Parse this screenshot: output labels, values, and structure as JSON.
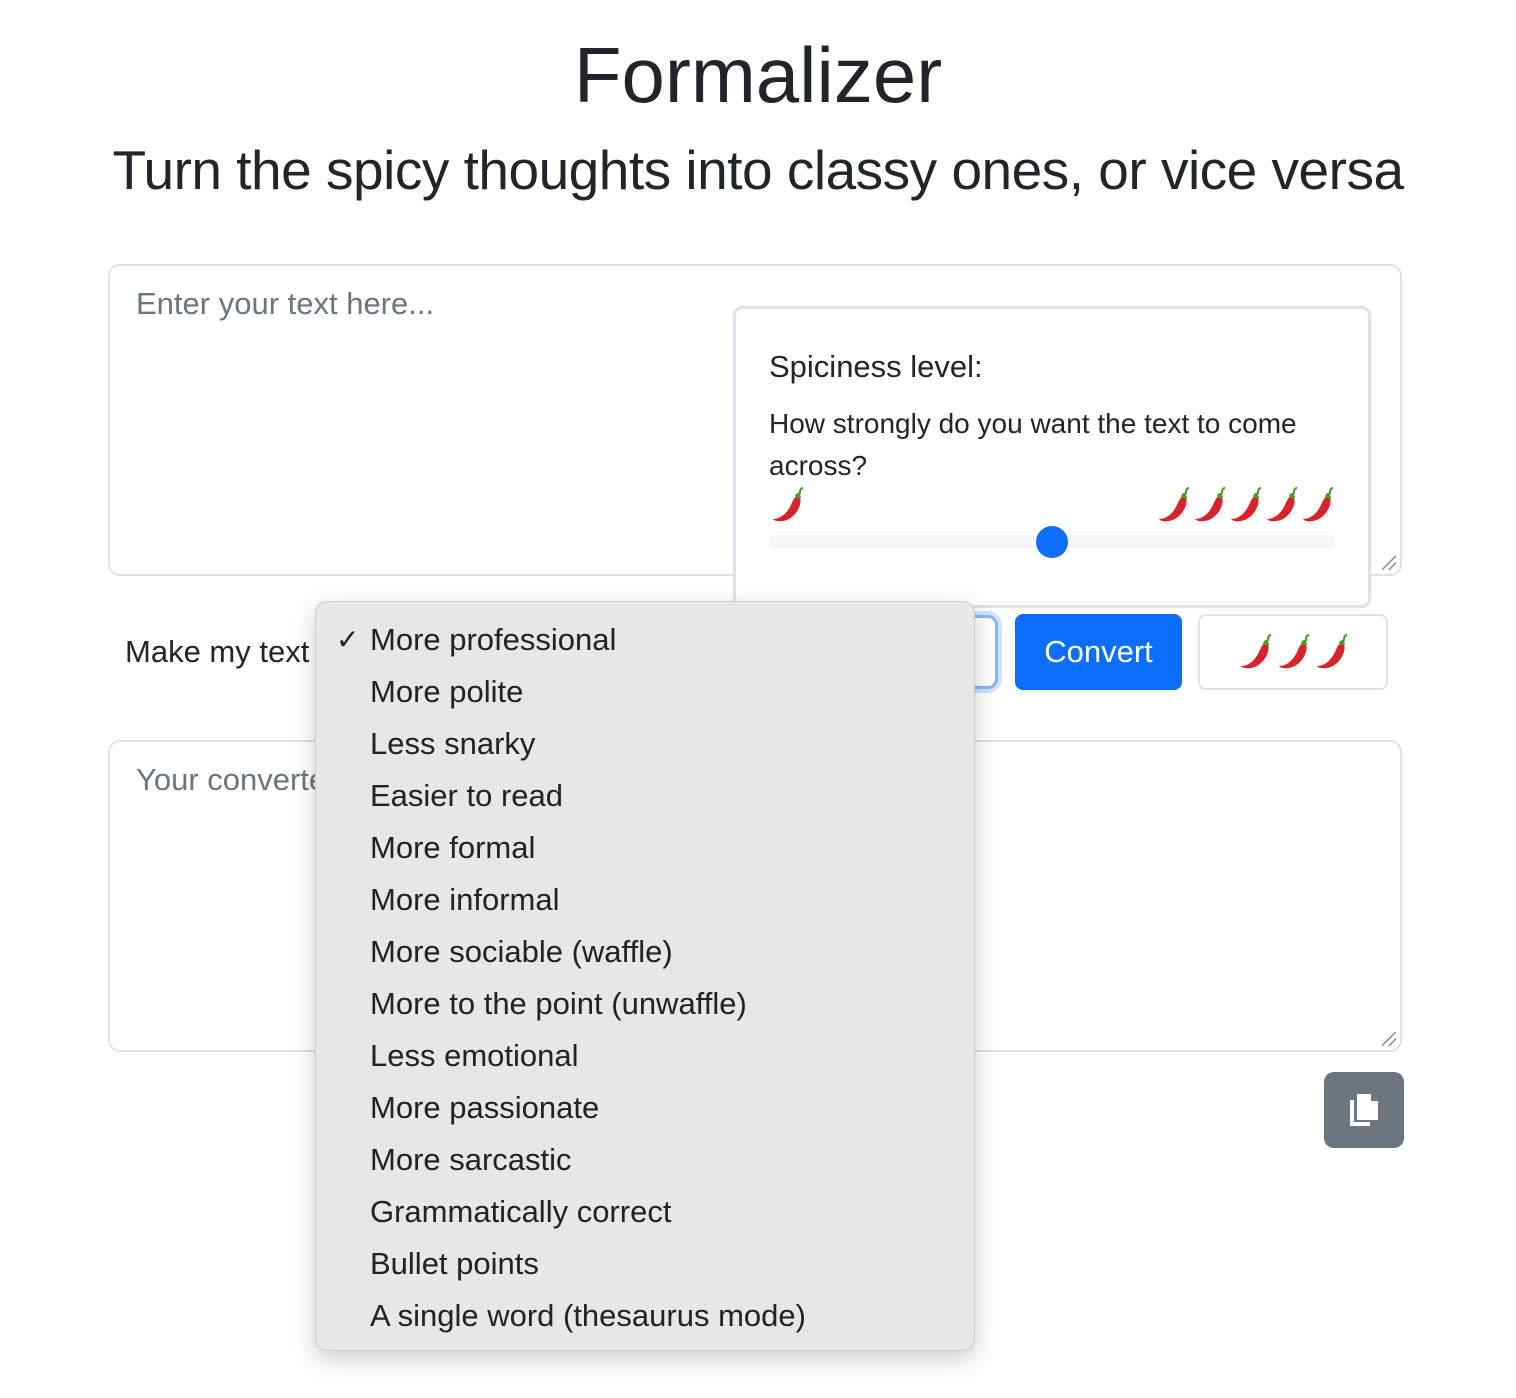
{
  "header": {
    "title": "Formalizer",
    "subtitle": "Turn the spicy thoughts into classy ones, or vice versa"
  },
  "input": {
    "placeholder": "Enter your text here..."
  },
  "spiciness": {
    "title": "Spiciness level:",
    "question": "How strongly do you want the text to come across?",
    "min_icon": "chili-pepper",
    "min_count": 1,
    "max_count": 5,
    "value_percent": 50
  },
  "controls": {
    "label": "Make my text",
    "selected": "More professional",
    "convert_label": "Convert",
    "spice_button_chilis": 3
  },
  "output": {
    "placeholder": "Your converted text will appear here..."
  },
  "dropdown": {
    "options": [
      "More professional",
      "More polite",
      "Less snarky",
      "Easier to read",
      "More formal",
      "More informal",
      "More sociable (waffle)",
      "More to the point (unwaffle)",
      "Less emotional",
      "More passionate",
      "More sarcastic",
      "Grammatically correct",
      "Bullet points",
      "A single word (thesaurus mode)"
    ],
    "selected_index": 0
  },
  "colors": {
    "primary": "#0d6efd",
    "secondary": "#6c757d",
    "chili": "#d9232b"
  }
}
